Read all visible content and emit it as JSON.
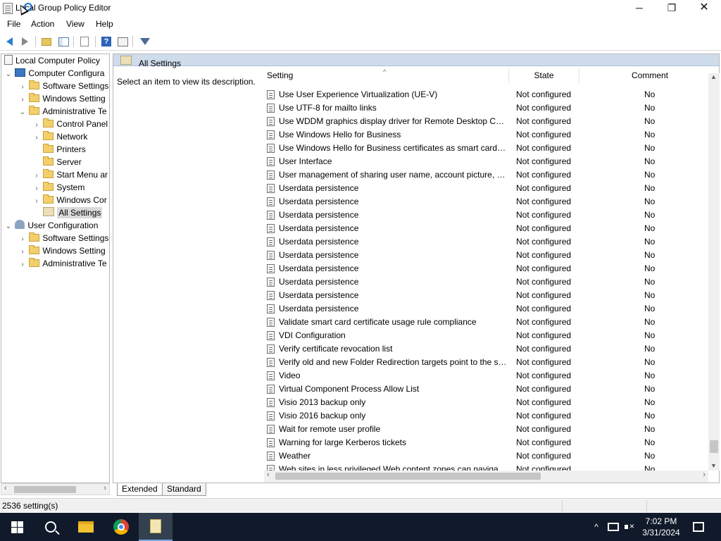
{
  "window": {
    "title": "Local Group Policy Editor",
    "controls": {
      "minimize": "─",
      "maximize": "❐",
      "close": "✕"
    }
  },
  "menu": [
    "File",
    "Action",
    "View",
    "Help"
  ],
  "toolbar": {
    "buttons": [
      "back-icon",
      "forward-icon",
      "up-folder-icon",
      "show-hide-tree-icon",
      "export-list-icon",
      "help-icon",
      "properties-icon",
      "filter-icon"
    ]
  },
  "tree": {
    "items": [
      {
        "label": "Local Computer Policy",
        "level": 0,
        "expander": "",
        "icon": "doc-icon"
      },
      {
        "label": "Computer Configura",
        "level": 1,
        "expander": "⌄",
        "icon": "computer-icon"
      },
      {
        "label": "Software Settings",
        "level": 2,
        "expander": "›",
        "icon": "folder-icon"
      },
      {
        "label": "Windows Setting",
        "level": 2,
        "expander": "›",
        "icon": "folder-icon"
      },
      {
        "label": "Administrative Te",
        "level": 2,
        "expander": "⌄",
        "icon": "folder-icon"
      },
      {
        "label": "Control Panel",
        "level": 3,
        "expander": "›",
        "icon": "folder-icon"
      },
      {
        "label": "Network",
        "level": 3,
        "expander": "›",
        "icon": "folder-icon"
      },
      {
        "label": "Printers",
        "level": 3,
        "expander": "",
        "icon": "folder-icon"
      },
      {
        "label": "Server",
        "level": 3,
        "expander": "",
        "icon": "folder-icon"
      },
      {
        "label": "Start Menu ar",
        "level": 3,
        "expander": "›",
        "icon": "folder-icon"
      },
      {
        "label": "System",
        "level": 3,
        "expander": "›",
        "icon": "folder-icon"
      },
      {
        "label": "Windows Cor",
        "level": 3,
        "expander": "›",
        "icon": "folder-icon"
      },
      {
        "label": "All Settings",
        "level": 3,
        "expander": "",
        "icon": "all-settings-icon",
        "selected": true
      },
      {
        "label": "User Configuration",
        "level": 1,
        "expander": "⌄",
        "icon": "user-icon"
      },
      {
        "label": "Software Settings",
        "level": 2,
        "expander": "›",
        "icon": "folder-icon"
      },
      {
        "label": "Windows Setting",
        "level": 2,
        "expander": "›",
        "icon": "folder-icon"
      },
      {
        "label": "Administrative Te",
        "level": 2,
        "expander": "›",
        "icon": "folder-icon"
      }
    ]
  },
  "right_pane": {
    "header": "All Settings",
    "description": "Select an item to view its description.",
    "columns": {
      "setting": "Setting",
      "state": "State",
      "comment": "Comment"
    },
    "rows": [
      {
        "setting": "Use User Experience Virtualization (UE-V)",
        "state": "Not configured",
        "comment": "No"
      },
      {
        "setting": "Use UTF-8 for mailto links",
        "state": "Not configured",
        "comment": "No"
      },
      {
        "setting": "Use WDDM graphics display driver for Remote Desktop Con...",
        "state": "Not configured",
        "comment": "No"
      },
      {
        "setting": "Use Windows Hello for Business",
        "state": "Not configured",
        "comment": "No"
      },
      {
        "setting": "Use Windows Hello for Business certificates as smart card ce...",
        "state": "Not configured",
        "comment": "No"
      },
      {
        "setting": "User Interface",
        "state": "Not configured",
        "comment": "No"
      },
      {
        "setting": "User management of sharing user name, account picture, a...",
        "state": "Not configured",
        "comment": "No"
      },
      {
        "setting": "Userdata persistence",
        "state": "Not configured",
        "comment": "No"
      },
      {
        "setting": "Userdata persistence",
        "state": "Not configured",
        "comment": "No"
      },
      {
        "setting": "Userdata persistence",
        "state": "Not configured",
        "comment": "No"
      },
      {
        "setting": "Userdata persistence",
        "state": "Not configured",
        "comment": "No"
      },
      {
        "setting": "Userdata persistence",
        "state": "Not configured",
        "comment": "No"
      },
      {
        "setting": "Userdata persistence",
        "state": "Not configured",
        "comment": "No"
      },
      {
        "setting": "Userdata persistence",
        "state": "Not configured",
        "comment": "No"
      },
      {
        "setting": "Userdata persistence",
        "state": "Not configured",
        "comment": "No"
      },
      {
        "setting": "Userdata persistence",
        "state": "Not configured",
        "comment": "No"
      },
      {
        "setting": "Userdata persistence",
        "state": "Not configured",
        "comment": "No"
      },
      {
        "setting": "Validate smart card certificate usage rule compliance",
        "state": "Not configured",
        "comment": "No"
      },
      {
        "setting": "VDI Configuration",
        "state": "Not configured",
        "comment": "No"
      },
      {
        "setting": "Verify certificate revocation list",
        "state": "Not configured",
        "comment": "No"
      },
      {
        "setting": "Verify old and new Folder Redirection targets point to the sa...",
        "state": "Not configured",
        "comment": "No"
      },
      {
        "setting": "Video",
        "state": "Not configured",
        "comment": "No"
      },
      {
        "setting": "Virtual Component Process Allow List",
        "state": "Not configured",
        "comment": "No"
      },
      {
        "setting": "Visio 2013 backup only",
        "state": "Not configured",
        "comment": "No"
      },
      {
        "setting": "Visio 2016 backup only",
        "state": "Not configured",
        "comment": "No"
      },
      {
        "setting": "Wait for remote user profile",
        "state": "Not configured",
        "comment": "No"
      },
      {
        "setting": "Warning for large Kerberos tickets",
        "state": "Not configured",
        "comment": "No"
      },
      {
        "setting": "Weather",
        "state": "Not configured",
        "comment": "No"
      },
      {
        "setting": "Web sites in less privileged Web content zones can navigate...",
        "state": "Not configured",
        "comment": "No"
      }
    ]
  },
  "tabs": [
    "Extended",
    "Standard"
  ],
  "status": {
    "text": "2536 setting(s)"
  },
  "taskbar": {
    "apps": [
      "start-icon",
      "search-icon",
      "file-explorer-icon",
      "chrome-icon",
      "group-policy-editor-icon"
    ],
    "tray": {
      "chevron": "^",
      "time": "7:02 PM",
      "date": "3/31/2024"
    }
  },
  "colors": {
    "header_band": "#cfdcec",
    "taskbar": "#101a2a",
    "selected": "#d9d9d9",
    "accent": "#2a7fd4"
  }
}
